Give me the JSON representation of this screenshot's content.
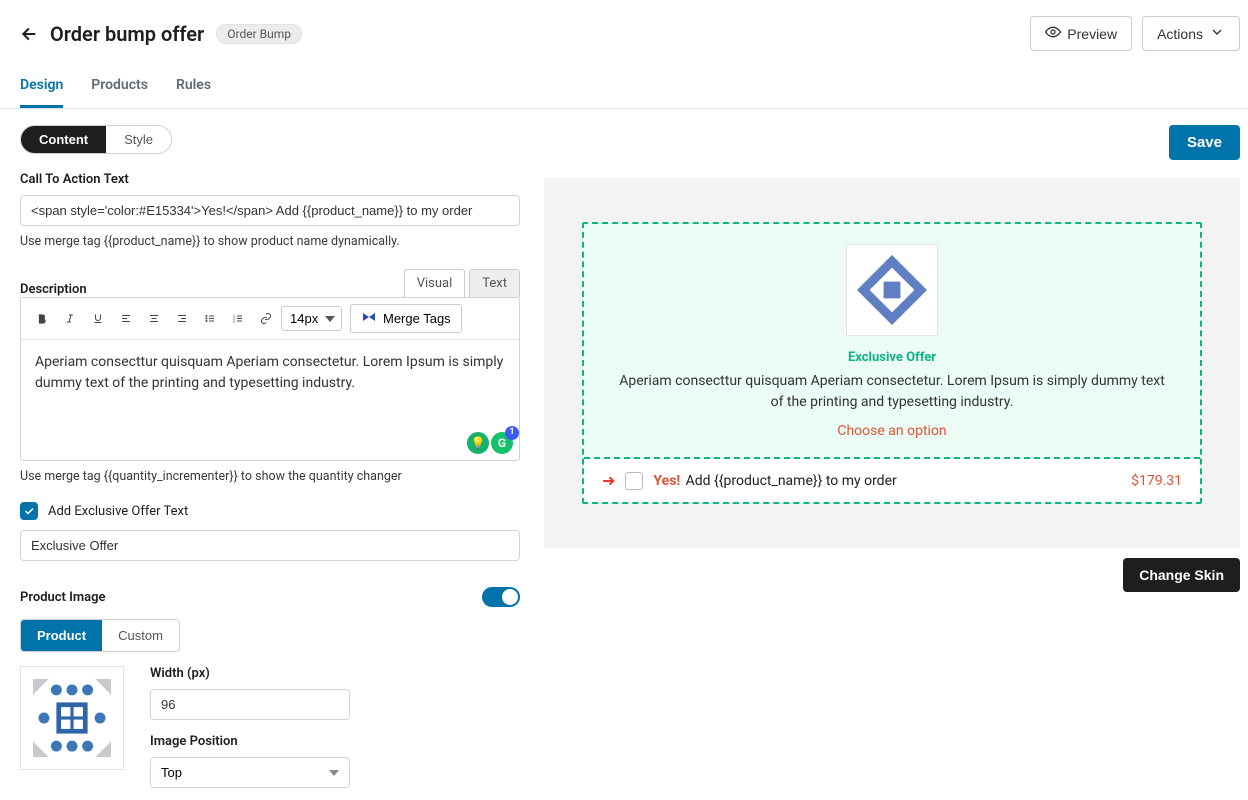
{
  "header": {
    "title": "Order bump offer",
    "tag": "Order Bump",
    "preview": "Preview",
    "actions": "Actions"
  },
  "tabs": {
    "design": "Design",
    "products": "Products",
    "rules": "Rules"
  },
  "subtabs": {
    "content": "Content",
    "style": "Style"
  },
  "save": "Save",
  "cta": {
    "label": "Call To Action Text",
    "value": "<span style='color:#E15334'>Yes!</span> Add {{product_name}} to my order",
    "hint": "Use merge tag {{product_name}} to show product name dynamically."
  },
  "desc": {
    "label": "Description",
    "visual": "Visual",
    "text_tab": "Text",
    "fontSize": "14px",
    "mergeTags": "Merge Tags",
    "body": "Aperiam consecttur quisquam Aperiam consectetur. Lorem Ipsum is simply dummy text of the printing and typesetting industry.",
    "hint": "Use merge tag {{quantity_incrementer}} to show the quantity changer",
    "badgeCount": "1"
  },
  "exclusive": {
    "checkbox": "Add Exclusive Offer Text",
    "value": "Exclusive Offer"
  },
  "image": {
    "label": "Product Image",
    "seg_product": "Product",
    "seg_custom": "Custom",
    "widthLabel": "Width (px)",
    "widthValue": "96",
    "posLabel": "Image Position",
    "posValue": "Top"
  },
  "preview": {
    "offerLabel": "Exclusive Offer",
    "desc": "Aperiam consecttur quisquam Aperiam consectetur. Lorem Ipsum is simply dummy text of the printing and typesetting industry.",
    "chooseOption": "Choose an option",
    "yes": "Yes!",
    "ctaText": "Add {{product_name}} to my order",
    "price": "$179.31",
    "changeSkin": "Change Skin"
  }
}
